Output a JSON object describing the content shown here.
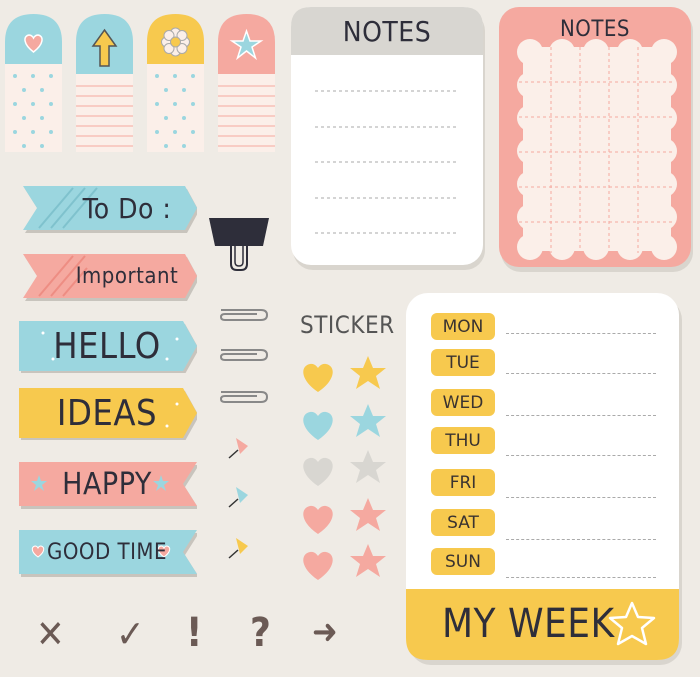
{
  "tabs": [
    {
      "icon": "heart-icon",
      "color": "#9bd6df",
      "pattern": "dots"
    },
    {
      "icon": "arrow-up-icon",
      "color": "#9bd6df",
      "pattern": "lines"
    },
    {
      "icon": "flower-icon",
      "color": "#f7c94e",
      "pattern": "dots"
    },
    {
      "icon": "star-icon",
      "color": "#f5a9a0",
      "pattern": "lines"
    }
  ],
  "notes_white": {
    "title": "NOTES"
  },
  "notes_pink": {
    "title": "NOTES"
  },
  "banners": [
    {
      "label": "To Do :",
      "color": "#9bd6df"
    },
    {
      "label": "Important",
      "color": "#f5a9a0"
    },
    {
      "label": "HELLO",
      "color": "#9bd6df"
    },
    {
      "label": "IDEAS",
      "color": "#f7c94e"
    },
    {
      "label": "HAPPY",
      "color": "#f5a9a0"
    },
    {
      "label": "GOOD TIME",
      "color": "#9bd6df"
    }
  ],
  "sticker": {
    "title": "STICKER"
  },
  "week": {
    "days": [
      "MON",
      "TUE",
      "WED",
      "THU",
      "FRI",
      "SAT",
      "SUN"
    ],
    "title": "MY WEEK"
  },
  "symbols": [
    "✕",
    "✓",
    "!",
    "?",
    "➜"
  ],
  "colors": {
    "blue": "#9bd6df",
    "pink": "#f5a9a0",
    "yellow": "#f7c94e",
    "gray": "#d8d6d1",
    "dark": "#2e2e3a"
  }
}
